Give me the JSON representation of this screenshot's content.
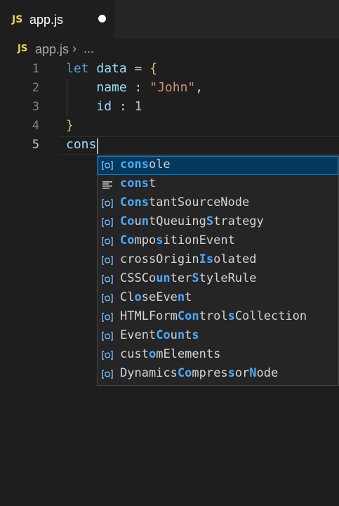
{
  "tab": {
    "badge": "JS",
    "title": "app.js"
  },
  "breadcrumb": {
    "badge": "JS",
    "file": "app.js",
    "separator": "›",
    "more": "..."
  },
  "editor": {
    "lines": [
      {
        "n": "1"
      },
      {
        "n": "2"
      },
      {
        "n": "3"
      },
      {
        "n": "4"
      },
      {
        "n": "5"
      }
    ],
    "tokens": {
      "let": "let",
      "data": "data",
      "eq": " = ",
      "open_brace": "{",
      "name": "name",
      "colon1": " : ",
      "john": "\"John\"",
      "comma": ",",
      "id": "id",
      "colon2": " : ",
      "one": "1",
      "close_brace": "}",
      "typed": "cons"
    }
  },
  "suggestions": [
    {
      "parts": [
        {
          "t": "cons",
          "h": true
        },
        {
          "t": "ole",
          "h": false
        }
      ],
      "icon": "variable-icon"
    },
    {
      "parts": [
        {
          "t": "cons",
          "h": true
        },
        {
          "t": "t",
          "h": false
        }
      ],
      "icon": "keyword-icon"
    },
    {
      "parts": [
        {
          "t": "Cons",
          "h": true
        },
        {
          "t": "tantSourceNode",
          "h": false
        }
      ],
      "icon": "variable-icon"
    },
    {
      "parts": [
        {
          "t": "Co",
          "h": true
        },
        {
          "t": "u",
          "h": false
        },
        {
          "t": "n",
          "h": true
        },
        {
          "t": "tQueuing",
          "h": false
        },
        {
          "t": "S",
          "h": true
        },
        {
          "t": "trategy",
          "h": false
        }
      ],
      "icon": "variable-icon"
    },
    {
      "parts": [
        {
          "t": "Co",
          "h": true
        },
        {
          "t": "mpo",
          "h": false
        },
        {
          "t": "s",
          "h": true
        },
        {
          "t": "itionEvent",
          "h": false
        }
      ],
      "icon": "variable-icon"
    },
    {
      "parts": [
        {
          "t": "crossOrigin",
          "h": false
        },
        {
          "t": "Is",
          "h": true
        },
        {
          "t": "olated",
          "h": false
        }
      ],
      "icon": "variable-icon"
    },
    {
      "parts": [
        {
          "t": "CSSCo",
          "h": false
        },
        {
          "t": "un",
          "h": true
        },
        {
          "t": "ter",
          "h": false
        },
        {
          "t": "S",
          "h": true
        },
        {
          "t": "tyleRule",
          "h": false
        }
      ],
      "icon": "variable-icon"
    },
    {
      "parts": [
        {
          "t": "Cl",
          "h": false
        },
        {
          "t": "o",
          "h": true
        },
        {
          "t": "seEve",
          "h": false
        },
        {
          "t": "n",
          "h": true
        },
        {
          "t": "t",
          "h": false
        }
      ],
      "icon": "variable-icon"
    },
    {
      "parts": [
        {
          "t": "HTMLForm",
          "h": false
        },
        {
          "t": "Con",
          "h": true
        },
        {
          "t": "trol",
          "h": false
        },
        {
          "t": "s",
          "h": true
        },
        {
          "t": "Collection",
          "h": false
        }
      ],
      "icon": "variable-icon"
    },
    {
      "parts": [
        {
          "t": "Event",
          "h": false
        },
        {
          "t": "Co",
          "h": true
        },
        {
          "t": "u",
          "h": false
        },
        {
          "t": "n",
          "h": true
        },
        {
          "t": "t",
          "h": false
        },
        {
          "t": "s",
          "h": true
        }
      ],
      "icon": "variable-icon"
    },
    {
      "parts": [
        {
          "t": "cust",
          "h": false
        },
        {
          "t": "o",
          "h": true
        },
        {
          "t": "mElements",
          "h": false
        }
      ],
      "icon": "variable-icon"
    },
    {
      "parts": [
        {
          "t": "Dynamics",
          "h": false
        },
        {
          "t": "Co",
          "h": true
        },
        {
          "t": "mpres",
          "h": false
        },
        {
          "t": "s",
          "h": true
        },
        {
          "t": "or",
          "h": false
        },
        {
          "t": "N",
          "h": true
        },
        {
          "t": "ode",
          "h": false
        }
      ],
      "icon": "variable-icon"
    }
  ],
  "colors": {
    "accent": "#007fd4",
    "selection": "#04395e",
    "match": "#4daafc",
    "keyword": "#569cd6",
    "js_badge": "#e8d44d"
  }
}
